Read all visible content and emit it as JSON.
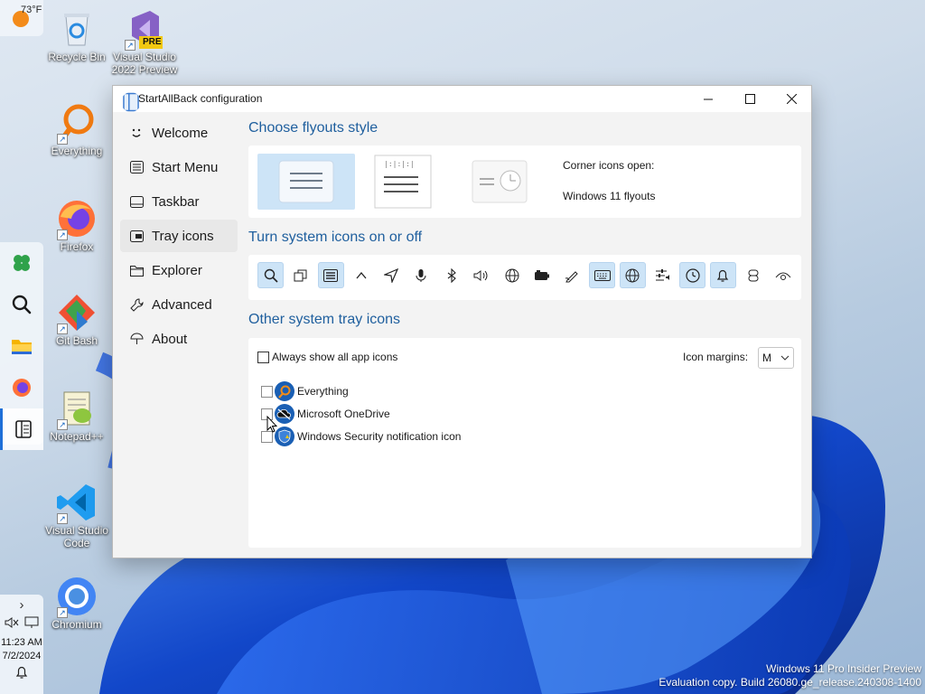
{
  "desktop": {
    "icons": [
      {
        "label": "Recycle Bin",
        "icon": "recycle-bin-icon"
      },
      {
        "label": "Visual Studio 2022 Preview",
        "icon": "visual-studio-icon",
        "badge": "PRE"
      },
      {
        "label": "Everything",
        "icon": "everything-icon"
      },
      {
        "label": "Firefox",
        "icon": "firefox-icon"
      },
      {
        "label": "Git Bash",
        "icon": "git-bash-icon"
      },
      {
        "label": "Notepad++",
        "icon": "notepad-plus-plus-icon"
      },
      {
        "label": "Visual Studio Code",
        "icon": "vscode-icon"
      },
      {
        "label": "Chromium",
        "icon": "chromium-icon"
      }
    ],
    "watermark": {
      "line1": "Windows 11 Pro Insider Preview",
      "line2": "Evaluation copy. Build 26080.ge_release.240308-1400"
    }
  },
  "taskbar": {
    "weather": "73°F",
    "time": "11:23 AM",
    "date": "7/2/2024",
    "chevron": "›"
  },
  "window": {
    "title": "StartAllBack configuration",
    "nav": [
      {
        "label": "Welcome",
        "icon": "smiley-icon"
      },
      {
        "label": "Start Menu",
        "icon": "start-menu-icon"
      },
      {
        "label": "Taskbar",
        "icon": "taskbar-icon"
      },
      {
        "label": "Tray icons",
        "icon": "tray-icon",
        "active": true
      },
      {
        "label": "Explorer",
        "icon": "folder-icon"
      },
      {
        "label": "Advanced",
        "icon": "wrench-icon"
      },
      {
        "label": "About",
        "icon": "umbrella-icon"
      }
    ],
    "flyouts": {
      "heading": "Choose flyouts style",
      "corner_label": "Corner icons open:",
      "corner_value": "Windows 11 flyouts"
    },
    "system_icons": {
      "heading": "Turn system icons on or off",
      "icons": [
        {
          "name": "search",
          "on": true
        },
        {
          "name": "task-view",
          "on": false
        },
        {
          "name": "widgets",
          "on": true
        },
        {
          "name": "overflow-chevron",
          "on": false
        },
        {
          "name": "location",
          "on": false
        },
        {
          "name": "microphone",
          "on": false
        },
        {
          "name": "bluetooth",
          "on": false
        },
        {
          "name": "volume",
          "on": false
        },
        {
          "name": "network",
          "on": false
        },
        {
          "name": "battery",
          "on": false
        },
        {
          "name": "pen",
          "on": false
        },
        {
          "name": "touch-keyboard",
          "on": true
        },
        {
          "name": "language",
          "on": true
        },
        {
          "name": "mixer",
          "on": false
        },
        {
          "name": "clock",
          "on": true
        },
        {
          "name": "notifications",
          "on": true
        },
        {
          "name": "copilot",
          "on": false
        },
        {
          "name": "eye",
          "on": false
        }
      ]
    },
    "other_tray": {
      "heading": "Other system tray icons",
      "always_show_label": "Always show all app icons",
      "always_show_checked": false,
      "margins_label": "Icon margins:",
      "margins_value": "M",
      "apps": [
        {
          "label": "Everything",
          "checked": false,
          "icon": "everything-icon"
        },
        {
          "label": "Microsoft OneDrive",
          "checked": false,
          "icon": "onedrive-icon"
        },
        {
          "label": "Windows Security notification icon",
          "checked": false,
          "icon": "windows-security-icon"
        }
      ]
    }
  }
}
